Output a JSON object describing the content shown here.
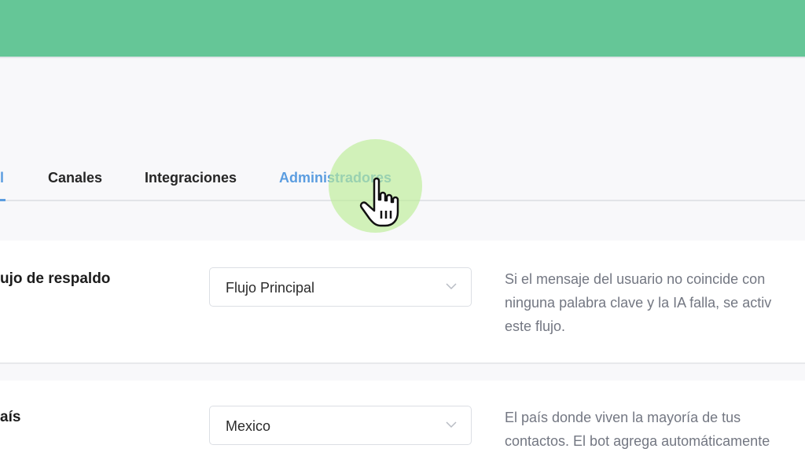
{
  "tabs": [
    {
      "label": "l",
      "active": false,
      "underlined": true
    },
    {
      "label": "Canales",
      "active": false
    },
    {
      "label": "Integraciones",
      "active": false
    },
    {
      "label": "Administradores",
      "active": true
    }
  ],
  "fallback_flow": {
    "label": "ujo de respaldo",
    "selected": "Flujo Principal",
    "description": [
      "Si el mensaje del usuario no coincide con",
      "ninguna palabra clave y la IA falla, se activ",
      "este flujo."
    ]
  },
  "country": {
    "label": "aís",
    "selected": "Mexico",
    "description": [
      "El país donde viven la mayoría de tus",
      "contactos. El bot agrega automáticamente"
    ]
  },
  "colors": {
    "header": "#65c697",
    "tab_active": "#5b9de0",
    "click_highlight": "#bcec96"
  },
  "icons": {
    "select_arrow": "chevron-down-icon",
    "cursor": "hand-pointer-icon"
  }
}
